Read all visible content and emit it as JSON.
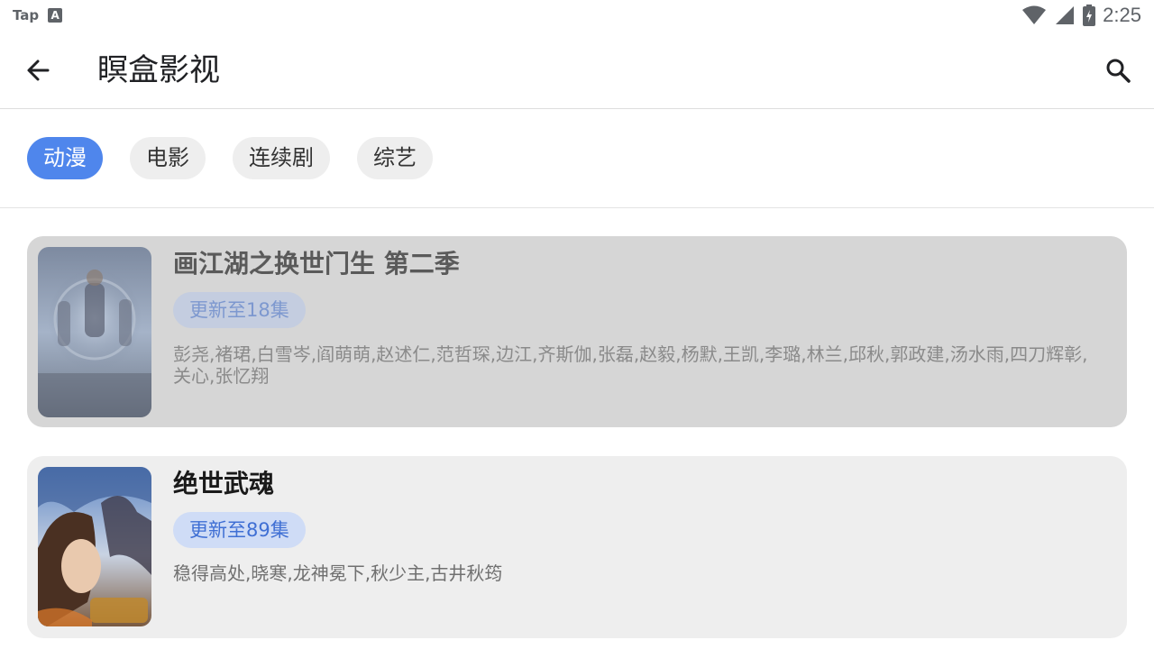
{
  "status_bar": {
    "left_text": "Tap",
    "left_icon": "A",
    "time": "2:25",
    "icons": [
      "wifi-icon",
      "signal-icon",
      "battery-charging-icon"
    ]
  },
  "app_bar": {
    "title": "瞑盒影视",
    "back_icon": "arrow-left-icon",
    "search_icon": "search-icon"
  },
  "tabs": [
    {
      "label": "动漫",
      "active": true
    },
    {
      "label": "电影",
      "active": false
    },
    {
      "label": "连续剧",
      "active": false
    },
    {
      "label": "综艺",
      "active": false
    }
  ],
  "items": [
    {
      "title": "画江湖之换世门生 第二季",
      "badge": "更新至18集",
      "cast": "彭尧,褚珺,白雪岑,阎萌萌,赵述仁,范哲琛,边江,齐斯伽,张磊,赵毅,杨默,王凯,李璐,林兰,邱秋,郭政建,汤水雨,四刀辉彰,关心,张忆翔",
      "pressed": true
    },
    {
      "title": "绝世武魂",
      "badge": "更新至89集",
      "cast": "稳得高处,晓寒,龙神冕下,秋少主,古井秋筠",
      "pressed": false
    }
  ],
  "colors": {
    "accent": "#4f86ec",
    "badge_bg": "#cfdcf6",
    "badge_text": "#3f6fd4",
    "card_bg": "#eeeeee",
    "card_pressed_bg": "#d6d6d6"
  }
}
